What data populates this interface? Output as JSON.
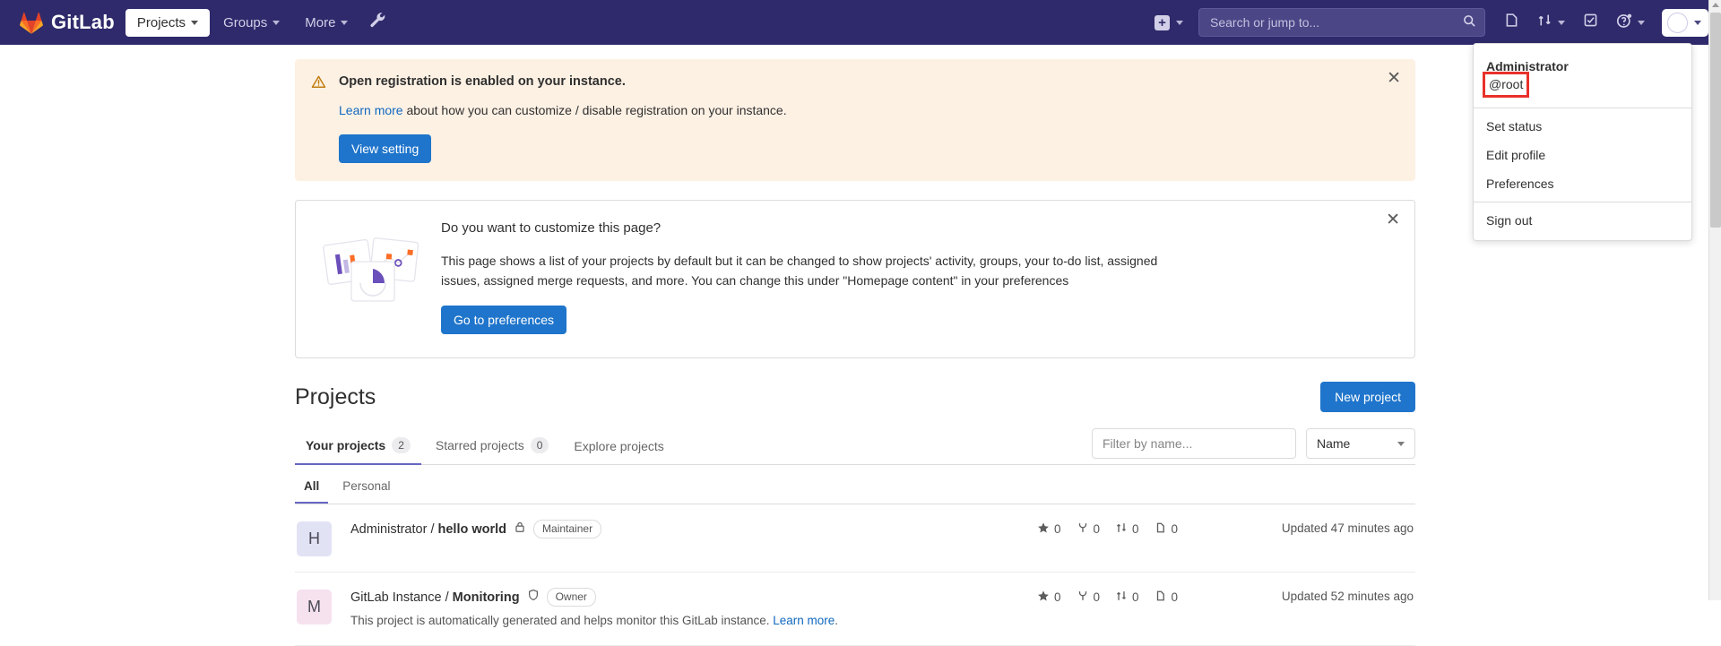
{
  "navbar": {
    "brand": "GitLab",
    "logo_icon": "gitlab-tanuki-icon",
    "items": [
      {
        "label": "Projects",
        "icon": "chevron-down-icon",
        "active": true
      },
      {
        "label": "Groups",
        "icon": "chevron-down-icon",
        "active": false
      },
      {
        "label": "More",
        "icon": "chevron-down-icon",
        "active": false
      }
    ],
    "admin_icon": "wrench-icon",
    "create_new_icon": "plus-square-icon",
    "create_new_caret": "chevron-down-icon",
    "search": {
      "placeholder": "Search or jump to...",
      "value": "",
      "icon": "search-icon"
    },
    "right_icons": [
      {
        "name": "issues-icon"
      },
      {
        "name": "merge-requests-icon"
      },
      {
        "name": "todos-icon"
      },
      {
        "name": "help-icon"
      }
    ],
    "avatar_icon": "user-avatar-icon",
    "avatar_caret": "chevron-down-icon"
  },
  "user_dropdown": {
    "name": "Administrator",
    "handle": "@root",
    "handle_highlight_color": "#e8312a",
    "items": [
      {
        "label": "Set status"
      },
      {
        "label": "Edit profile"
      },
      {
        "label": "Preferences"
      }
    ],
    "sign_out": "Sign out"
  },
  "alert": {
    "icon": "warning-triangle-icon",
    "title": "Open registration is enabled on your instance.",
    "link_text": "Learn more",
    "desc_rest": " about how you can customize / disable registration on your instance.",
    "button": "View setting",
    "close_icon": "close-icon",
    "bg_color": "#fdf1e4"
  },
  "customize_card": {
    "illustration_icon": "charts-cards-illustration",
    "title": "Do you want to customize this page?",
    "body": "This page shows a list of your projects by default but it can be changed to show projects' activity, groups, your to-do list, assigned issues, assigned merge requests, and more. You can change this under \"Homepage content\" in your preferences",
    "button": "Go to preferences",
    "close_icon": "close-icon"
  },
  "projects": {
    "page_title": "Projects",
    "new_project_button": "New project",
    "tabs": [
      {
        "label": "Your projects",
        "count": "2",
        "active": true
      },
      {
        "label": "Starred projects",
        "count": "0",
        "active": false
      },
      {
        "label": "Explore projects",
        "count": null,
        "active": false
      }
    ],
    "filter": {
      "placeholder": "Filter by name...",
      "value": ""
    },
    "sort": {
      "value": "Name",
      "icon": "chevron-down-icon"
    },
    "subtabs": [
      {
        "label": "All",
        "active": true
      },
      {
        "label": "Personal",
        "active": false
      }
    ],
    "rows": [
      {
        "avatar_letter": "H",
        "avatar_color": "#e2e2f5",
        "namespace": "Administrator / ",
        "name": "hello world",
        "visibility_icon": "lock-icon",
        "role_badge": "Maintainer",
        "description": "",
        "description_link": "",
        "stats": [
          {
            "icon": "star-icon",
            "value": "0"
          },
          {
            "icon": "fork-icon",
            "value": "0"
          },
          {
            "icon": "merge-request-icon",
            "value": "0"
          },
          {
            "icon": "issue-icon",
            "value": "0"
          }
        ],
        "updated": "Updated 47 minutes ago"
      },
      {
        "avatar_letter": "M",
        "avatar_color": "#f6e1ef",
        "namespace": "GitLab Instance / ",
        "name": "Monitoring",
        "visibility_icon": "shield-icon",
        "role_badge": "Owner",
        "description": "This project is automatically generated and helps monitor this GitLab instance. ",
        "description_link": "Learn more",
        "stats": [
          {
            "icon": "star-icon",
            "value": "0"
          },
          {
            "icon": "fork-icon",
            "value": "0"
          },
          {
            "icon": "merge-request-icon",
            "value": "0"
          },
          {
            "icon": "issue-icon",
            "value": "0"
          }
        ],
        "updated": "Updated 52 minutes ago"
      }
    ]
  },
  "theme": {
    "navbar_bg": "#2f2a6b",
    "primary_blue": "#1f75cb",
    "link_blue": "#1068bf",
    "active_tab_underline": "#6666c4"
  },
  "scrollbar": {
    "up_icon": "scroll-up-arrow-icon"
  }
}
